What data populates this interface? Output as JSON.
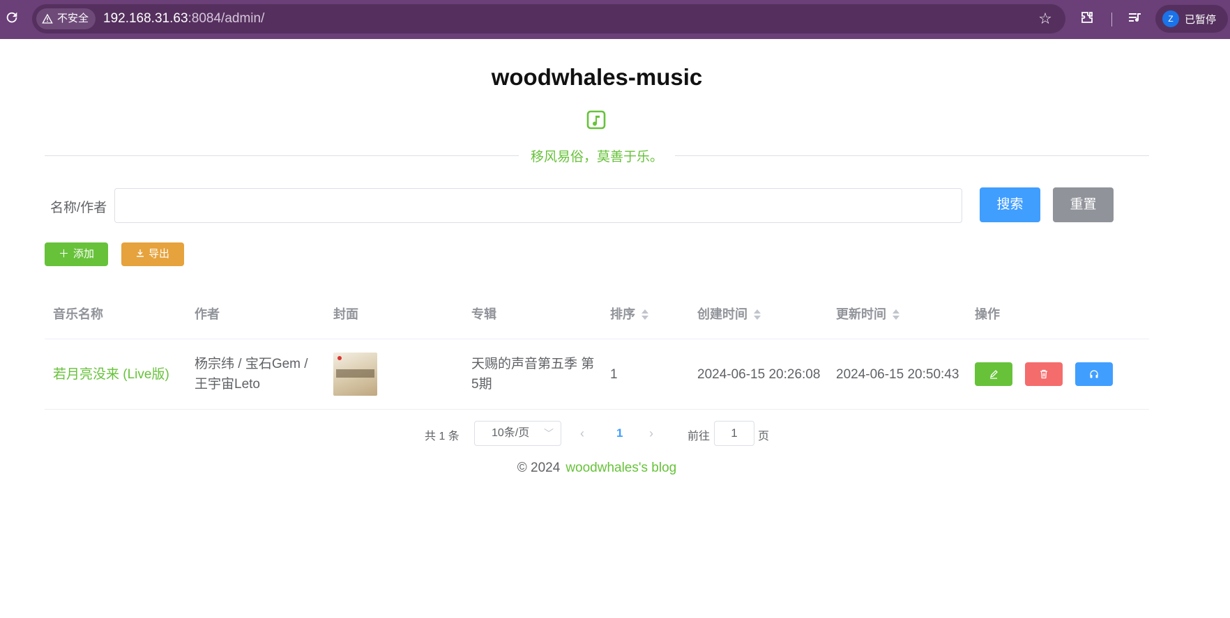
{
  "browser": {
    "security_label": "不安全",
    "url_host": "192.168.31.63",
    "url_path": ":8084/admin/",
    "profile_initial": "Z",
    "profile_label": "已暂停"
  },
  "header": {
    "title": "woodwhales-music",
    "slogan": "移风易俗，莫善于乐。"
  },
  "search": {
    "label": "名称/作者",
    "value": "",
    "placeholder": "",
    "search_button": "搜索",
    "reset_button": "重置"
  },
  "actions": {
    "add_label": "添加",
    "export_label": "导出"
  },
  "table": {
    "columns": [
      "音乐名称",
      "作者",
      "封面",
      "专辑",
      "排序",
      "创建时间",
      "更新时间",
      "操作"
    ],
    "rows": [
      {
        "name": "若月亮没来 (Live版)",
        "author": "杨宗纬 / 宝石Gem / 王宇宙Leto",
        "album": "天赐的声音第五季 第5期",
        "sort": "1",
        "created": "2024-06-15 20:26:08",
        "updated": "2024-06-15 20:50:43"
      }
    ]
  },
  "pagination": {
    "total_text": "共 1 条",
    "page_size": "10条/页",
    "current_page": "1",
    "goto_prefix": "前往",
    "goto_value": "1",
    "goto_suffix": "页"
  },
  "footer": {
    "copyright": "©  2024",
    "blog_link": "woodwhales's blog"
  },
  "colors": {
    "brand_green": "#67c23a",
    "primary_blue": "#409eff",
    "warning_orange": "#e6a23c",
    "danger_red": "#f56c6c",
    "info_gray": "#909399",
    "browser_bar": "#6b3f78"
  }
}
